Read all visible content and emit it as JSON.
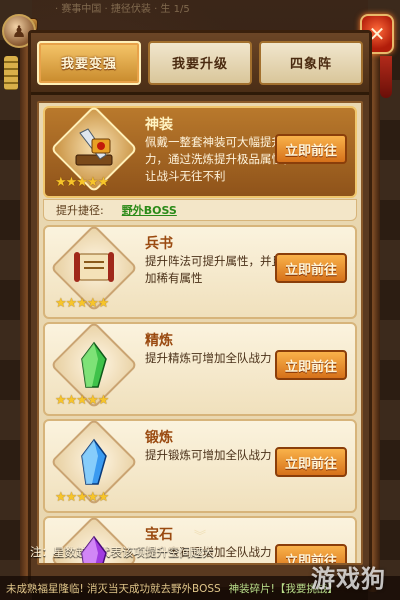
{
  "background": {
    "top_text": "· 赛事中国 · 捷径伏装 · 生 1/5"
  },
  "avatar_glyph": "♟",
  "close_label": "✕",
  "tabs": [
    {
      "label": "我要变强",
      "active": true
    },
    {
      "label": "我要升级",
      "active": false
    },
    {
      "label": "四象阵",
      "active": false
    }
  ],
  "cards": [
    {
      "title": "神装",
      "desc": "佩戴一整套神装可大幅提升战力，通过洗炼提升极品属性，让战斗无往不利",
      "button": "立即前往",
      "stars": "★★★★★",
      "icon": "weapon-icon",
      "highlight": true
    },
    {
      "title": "兵书",
      "desc": "提升阵法可提升属性，并且增加稀有属性",
      "button": "立即前往",
      "stars": "★★★★★",
      "icon": "scroll-icon"
    },
    {
      "title": "精炼",
      "desc": "提升精炼可增加全队战力",
      "button": "立即前往",
      "stars": "★★★★★",
      "icon": "green-crystal-icon"
    },
    {
      "title": "锻炼",
      "desc": "提升锻炼可增加全队战力",
      "button": "立即前往",
      "stars": "★★★★★",
      "icon": "blue-crystal-icon"
    },
    {
      "title": "宝石",
      "desc": "提升宝石可增加全队战力",
      "button": "立即前往",
      "stars": "★★★★★",
      "icon": "purple-crystal-icon"
    }
  ],
  "route": {
    "label": "提升捷径:",
    "link": "野外BOSS"
  },
  "note": "注：星数越高代表该项提升空间越大",
  "bottom": {
    "line1": "神装碎片!【我要挑战】",
    "line2": "未成熟福星隆临! 消灭当天成功就去野外BOSS"
  },
  "watermark": "游戏狗",
  "colors": {
    "accent": "#d6711a",
    "highlight_card": "#b9792c",
    "route_link": "#2a8a18",
    "star": "#f7c52a"
  }
}
